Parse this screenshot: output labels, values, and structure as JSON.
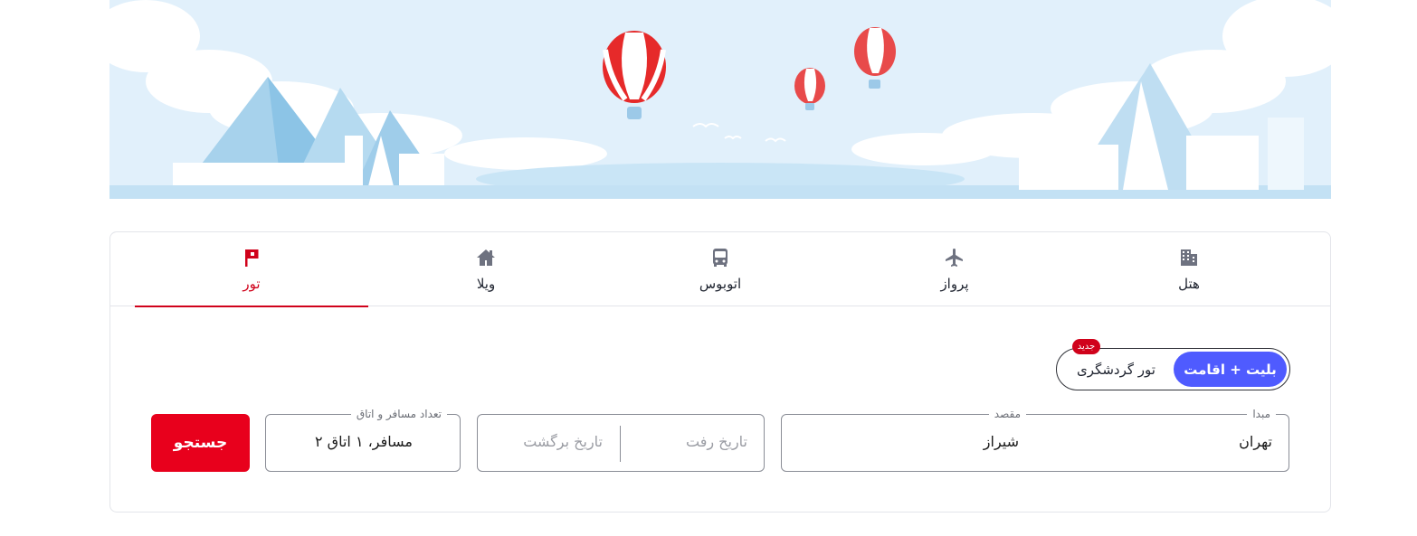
{
  "tabs": [
    {
      "label": "هتل",
      "icon": "building-icon"
    },
    {
      "label": "پرواز",
      "icon": "airplane-icon"
    },
    {
      "label": "اتوبوس",
      "icon": "bus-icon"
    },
    {
      "label": "ویلا",
      "icon": "house-icon"
    },
    {
      "label": "تور",
      "icon": "flag-icon",
      "active": true
    }
  ],
  "tour_type": {
    "options": [
      "بلیت + اقامت",
      "تور گردشگری"
    ],
    "selected": "بلیت + اقامت",
    "new_badge": "جدید"
  },
  "search": {
    "origin_label": "مبدا",
    "origin_value": "تهران",
    "destination_label": "مقصد",
    "destination_value": "شیراز",
    "depart_placeholder": "تاریخ رفت",
    "return_placeholder": "تاریخ برگشت",
    "passengers_label": "تعداد مسافر و اتاق",
    "passengers_value": "۲ مسافر، ۱ اتاق",
    "submit_label": "جستجو"
  },
  "colors": {
    "accent_red": "#e8001c",
    "active_tab_red": "#d0021b",
    "segment_blue": "#4f5bff",
    "sky": "#e3f1fb"
  }
}
